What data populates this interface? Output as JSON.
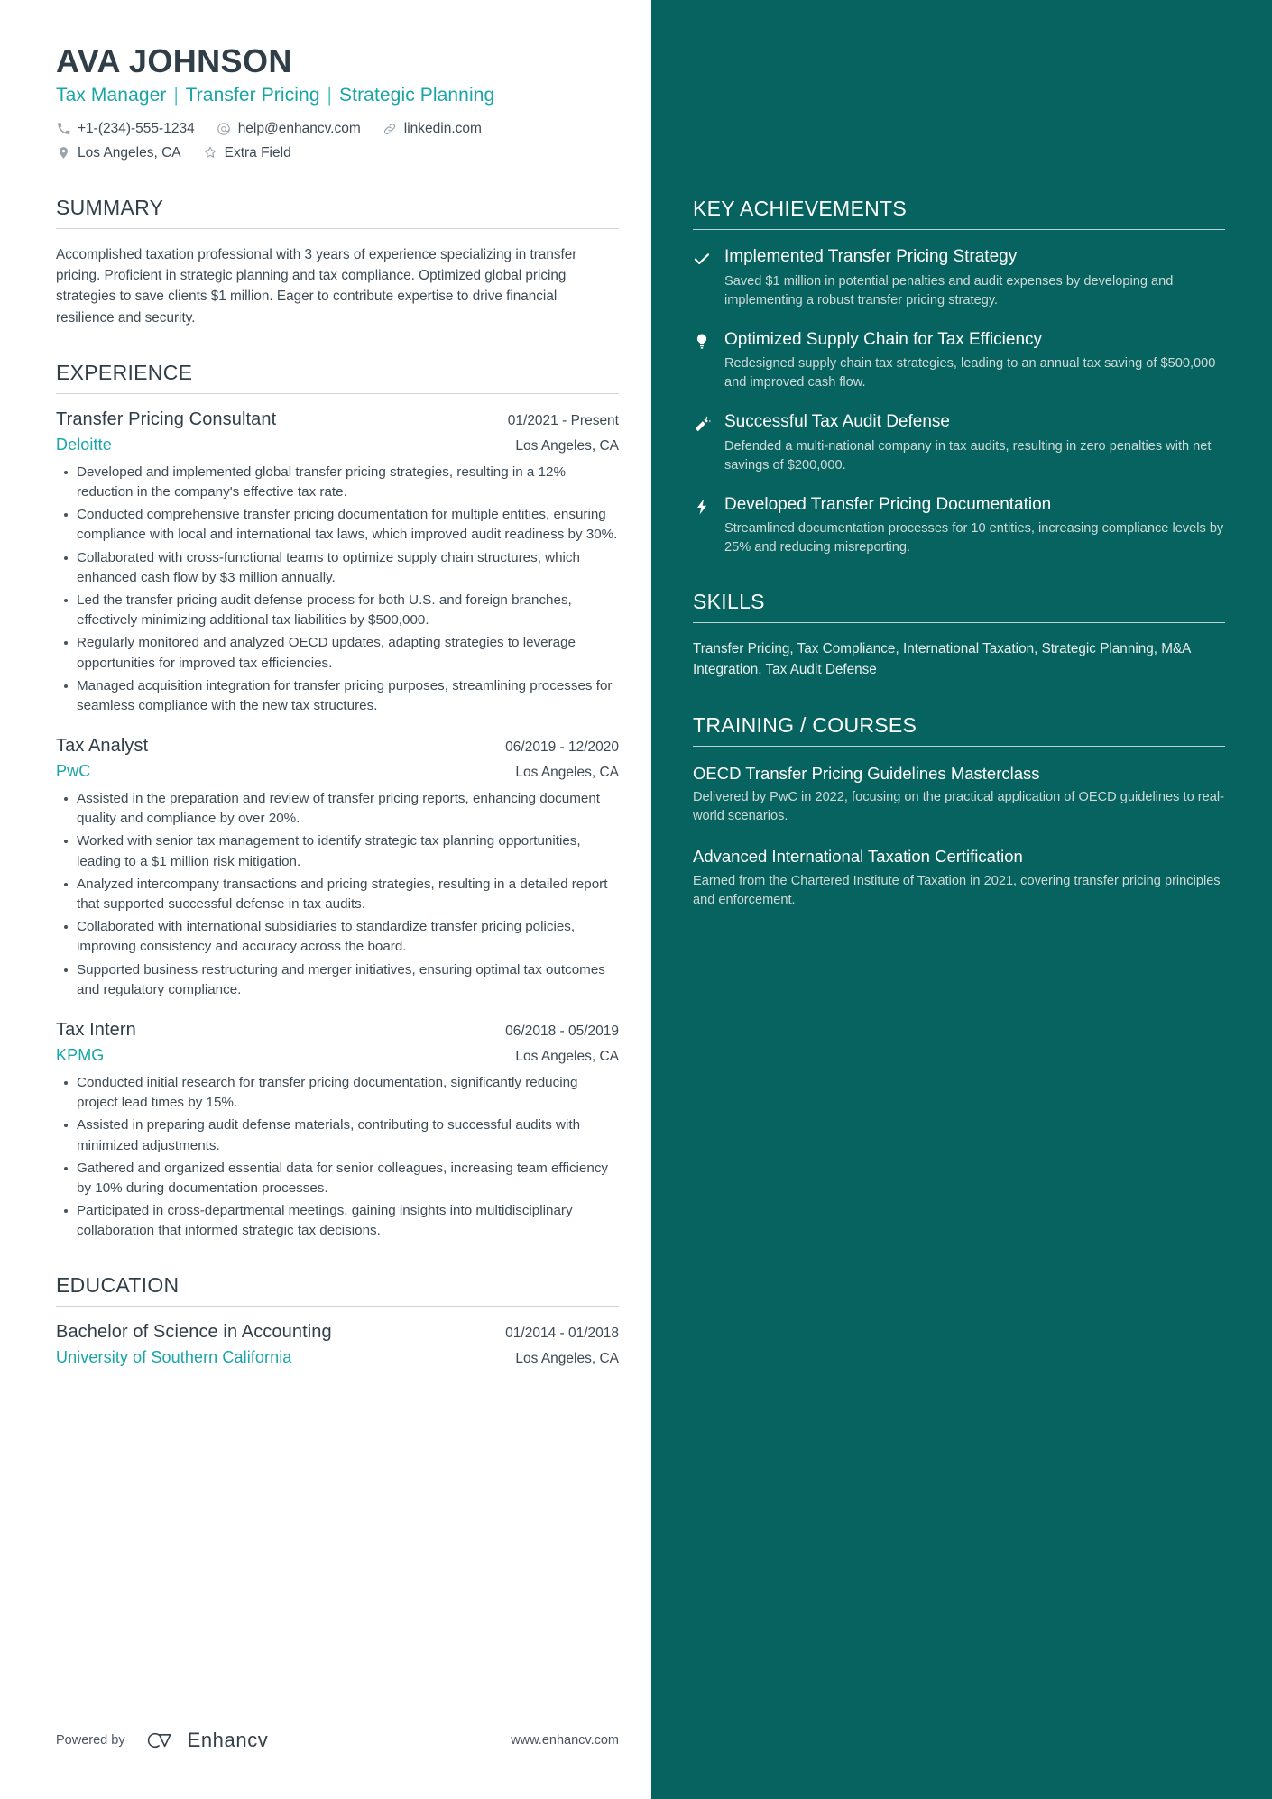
{
  "header": {
    "name": "AVA JOHNSON",
    "headline_parts": [
      "Tax Manager",
      "Transfer Pricing",
      "Strategic Planning"
    ],
    "headline_separator": "|",
    "contacts_row1": [
      {
        "icon": "phone-icon",
        "text": "+1-(234)-555-1234"
      },
      {
        "icon": "email-icon",
        "text": "help@enhancv.com"
      },
      {
        "icon": "link-icon",
        "text": "linkedin.com"
      }
    ],
    "contacts_row2": [
      {
        "icon": "location-pin-icon",
        "text": "Los Angeles, CA"
      },
      {
        "icon": "star-icon",
        "text": "Extra Field"
      }
    ]
  },
  "summary": {
    "title": "SUMMARY",
    "text": "Accomplished taxation professional with 3 years of experience specializing in transfer pricing. Proficient in strategic planning and tax compliance. Optimized global pricing strategies to save clients $1 million. Eager to contribute expertise to drive financial resilience and security."
  },
  "experience": {
    "title": "EXPERIENCE",
    "entries": [
      {
        "role": "Transfer Pricing Consultant",
        "date": "01/2021 - Present",
        "company": "Deloitte",
        "location": "Los Angeles, CA",
        "bullets": [
          "Developed and implemented global transfer pricing strategies, resulting in a 12% reduction in the company's effective tax rate.",
          "Conducted comprehensive transfer pricing documentation for multiple entities, ensuring compliance with local and international tax laws, which improved audit readiness by 30%.",
          "Collaborated with cross-functional teams to optimize supply chain structures, which enhanced cash flow by $3 million annually.",
          "Led the transfer pricing audit defense process for both U.S. and foreign branches, effectively minimizing additional tax liabilities by $500,000.",
          "Regularly monitored and analyzed OECD updates, adapting strategies to leverage opportunities for improved tax efficiencies.",
          "Managed acquisition integration for transfer pricing purposes, streamlining processes for seamless compliance with the new tax structures."
        ]
      },
      {
        "role": "Tax Analyst",
        "date": "06/2019 - 12/2020",
        "company": "PwC",
        "location": "Los Angeles, CA",
        "bullets": [
          "Assisted in the preparation and review of transfer pricing reports, enhancing document quality and compliance by over 20%.",
          "Worked with senior tax management to identify strategic tax planning opportunities, leading to a $1 million risk mitigation.",
          "Analyzed intercompany transactions and pricing strategies, resulting in a detailed report that supported successful defense in tax audits.",
          "Collaborated with international subsidiaries to standardize transfer pricing policies, improving consistency and accuracy across the board.",
          "Supported business restructuring and merger initiatives, ensuring optimal tax outcomes and regulatory compliance."
        ]
      },
      {
        "role": "Tax Intern",
        "date": "06/2018 - 05/2019",
        "company": "KPMG",
        "location": "Los Angeles, CA",
        "bullets": [
          "Conducted initial research for transfer pricing documentation, significantly reducing project lead times by 15%.",
          "Assisted in preparing audit defense materials, contributing to successful audits with minimized adjustments.",
          "Gathered and organized essential data for senior colleagues, increasing team efficiency by 10% during documentation processes.",
          "Participated in cross-departmental meetings, gaining insights into multidisciplinary collaboration that informed strategic tax decisions."
        ]
      }
    ]
  },
  "education": {
    "title": "EDUCATION",
    "entries": [
      {
        "degree": "Bachelor of Science in Accounting",
        "date": "01/2014 - 01/2018",
        "school": "University of Southern California",
        "location": "Los Angeles, CA"
      }
    ]
  },
  "footer": {
    "powered_by": "Powered by",
    "brand": "Enhancv",
    "url": "www.enhancv.com"
  },
  "sidebar": {
    "achievements": {
      "title": "KEY ACHIEVEMENTS",
      "items": [
        {
          "icon": "check-icon",
          "title": "Implemented Transfer Pricing Strategy",
          "desc": "Saved $1 million in potential penalties and audit expenses by developing and implementing a robust transfer pricing strategy."
        },
        {
          "icon": "lightbulb-icon",
          "title": "Optimized Supply Chain for Tax Efficiency",
          "desc": "Redesigned supply chain tax strategies, leading to an annual tax saving of $500,000 and improved cash flow."
        },
        {
          "icon": "magic-wand-icon",
          "title": "Successful Tax Audit Defense",
          "desc": "Defended a multi-national company in tax audits, resulting in zero penalties with net savings of $200,000."
        },
        {
          "icon": "lightning-bolt-icon",
          "title": "Developed Transfer Pricing Documentation",
          "desc": "Streamlined documentation processes for 10 entities, increasing compliance levels by 25% and reducing misreporting."
        }
      ]
    },
    "skills": {
      "title": "SKILLS",
      "text": "Transfer Pricing, Tax Compliance, International Taxation, Strategic Planning, M&A Integration, Tax Audit Defense"
    },
    "training": {
      "title": "TRAINING / COURSES",
      "items": [
        {
          "title": "OECD Transfer Pricing Guidelines Masterclass",
          "desc": "Delivered by PwC in 2022, focusing on the practical application of OECD guidelines to real-world scenarios."
        },
        {
          "title": "Advanced International Taxation Certification",
          "desc": "Earned from the Chartered Institute of Taxation in 2021, covering transfer pricing principles and enforcement."
        }
      ]
    }
  },
  "theme": {
    "accent_teal": "#19a5a8",
    "sidebar_bg": "#07635f",
    "heading_color": "#303e48"
  }
}
